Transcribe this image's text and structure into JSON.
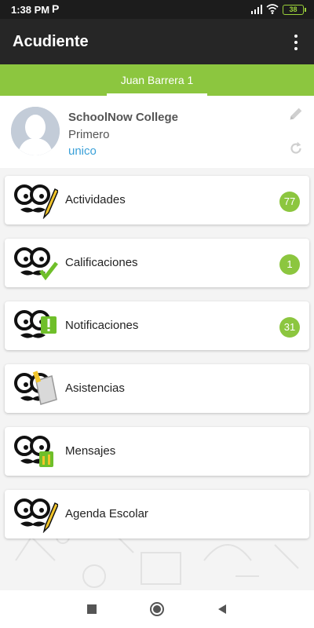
{
  "status_bar": {
    "time": "1:38 PM",
    "app_indicator": "P",
    "battery": "38",
    "icons": [
      "signal-icon",
      "wifi-icon",
      "battery-icon"
    ]
  },
  "app_bar": {
    "title": "Acudiente",
    "menu_icon": "more-vert-icon"
  },
  "tabs": [
    {
      "label": "Juan Barrera 1",
      "selected": true
    }
  ],
  "profile": {
    "school": "SchoolNow College",
    "grade": "Primero",
    "section": "unico",
    "edit_icon": "pencil-icon",
    "refresh_icon": "refresh-icon"
  },
  "menu": [
    {
      "label": "Actividades",
      "badge": "77",
      "icon": "mascot-pencil-icon"
    },
    {
      "label": "Calificaciones",
      "badge": "1",
      "icon": "mascot-check-icon"
    },
    {
      "label": "Notificaciones",
      "badge": "31",
      "icon": "mascot-alert-icon"
    },
    {
      "label": "Asistencias",
      "badge": "",
      "icon": "mascot-clipboard-icon"
    },
    {
      "label": "Mensajes",
      "badge": "",
      "icon": "mascot-message-icon"
    },
    {
      "label": "Agenda Escolar",
      "badge": "",
      "icon": "mascot-pencil-icon"
    }
  ],
  "colors": {
    "accent": "#8cc63f",
    "app_bar": "#262626",
    "status_bar": "#1c1c1c",
    "link": "#3aa0d8"
  },
  "nav_bar": {
    "icons": [
      "recent-apps-icon",
      "home-icon",
      "back-icon"
    ]
  }
}
